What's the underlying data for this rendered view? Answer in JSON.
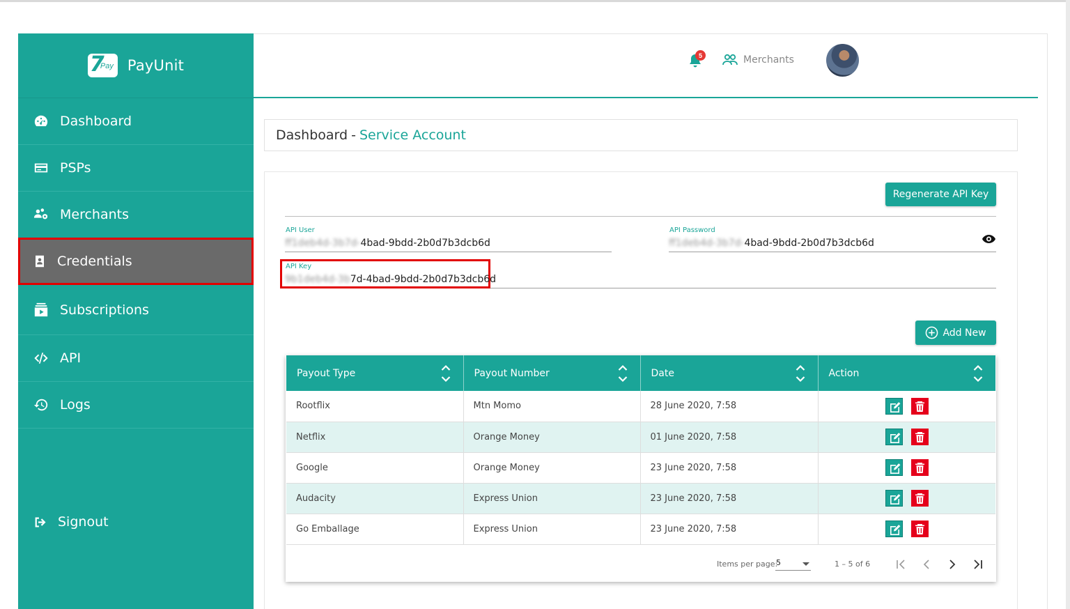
{
  "app": {
    "name": "PayUnit"
  },
  "sidebar": {
    "items": [
      {
        "label": "Dashboard",
        "icon": "dashboard-gauge-icon"
      },
      {
        "label": "PSPs",
        "icon": "credit-card-icon"
      },
      {
        "label": "Merchants",
        "icon": "users-gear-icon"
      },
      {
        "label": "Credentials",
        "icon": "id-badge-icon",
        "active": true
      },
      {
        "label": "Subscriptions",
        "icon": "subscriptions-icon"
      },
      {
        "label": "API",
        "icon": "code-icon"
      },
      {
        "label": "Logs",
        "icon": "history-icon"
      }
    ],
    "signout": "Signout"
  },
  "header": {
    "notifications_count": "5",
    "merchants_label": "Merchants"
  },
  "breadcrumb": {
    "root": "Dashboard",
    "separator": "-",
    "current": "Service Account"
  },
  "credentials": {
    "regenerate_label": "Regenerate API Key",
    "api_user": {
      "label": "API User",
      "masked": "ff1deb4d-3b7d-",
      "value": "4bad-9bdd-2b0d7b3dcb6d"
    },
    "api_password": {
      "label": "API Password",
      "masked": "ff1deb4d-3b7d-",
      "value": "4bad-9bdd-2b0d7b3dcb6d"
    },
    "api_key": {
      "label": "API Key",
      "masked": "9b1deb4d-3b",
      "value": "7d-4bad-9bdd-2b0d7b3dcb6d"
    }
  },
  "payouts": {
    "add_label": "Add New",
    "columns": [
      "Payout Type",
      "Payout Number",
      "Date",
      "Action"
    ],
    "rows": [
      [
        "Rootflix",
        "Mtn Momo",
        "28 June 2020, 7:58"
      ],
      [
        "Netflix",
        "Orange Money",
        "01 June 2020, 7:58"
      ],
      [
        "Google",
        "Orange Money",
        "23 June 2020, 7:58"
      ],
      [
        "Audacity",
        "Express Union",
        "23 June 2020, 7:58"
      ],
      [
        "Go Emballage",
        "Express Union",
        "23 June 2020, 7:58"
      ]
    ]
  },
  "paginator": {
    "items_per_page_label": "Items per page:",
    "items_per_page": "5",
    "range": "1 – 5 of 6"
  },
  "colors": {
    "accent": "#1aa598",
    "active_nav": "#6a6a6a",
    "highlight": "#e20000",
    "delete": "#e5001b"
  }
}
